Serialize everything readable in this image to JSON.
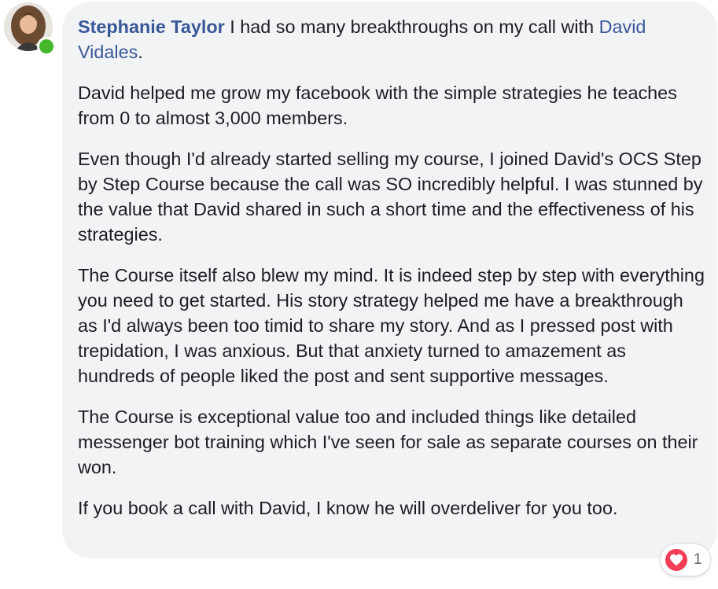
{
  "comment": {
    "author": "Stephanie Taylor",
    "intro_text": " I had so many breakthroughs on my call with ",
    "mention": "David Vidales",
    "intro_end": ".",
    "paragraphs": [
      "David helped me grow my facebook with the simple strategies he teaches from 0 to almost 3,000 members.",
      "Even though I'd already started selling my course, I joined David's OCS Step by Step Course because the call was SO incredibly helpful. I was stunned by the value that David shared in such a short time and the effectiveness of his strategies.",
      "The Course itself also blew my mind. It is indeed step by step with everything you need to get started. His story strategy helped me have a breakthrough as I'd always been too timid to share my story. And as I pressed post with trepidation, I was anxious. But that anxiety turned to amazement as hundreds of people liked the post and sent supportive messages.",
      "The Course is exceptional value too and included things like detailed messenger bot training which I've seen for sale as separate courses on their won.",
      "If you book a call with David, I know he will overdeliver for you too."
    ]
  },
  "reactions": {
    "icon": "love-heart-icon",
    "count": "1"
  },
  "colors": {
    "link": "#385898",
    "bubble": "#f2f3f5",
    "online": "#42b72a",
    "love": "#f33e58"
  }
}
